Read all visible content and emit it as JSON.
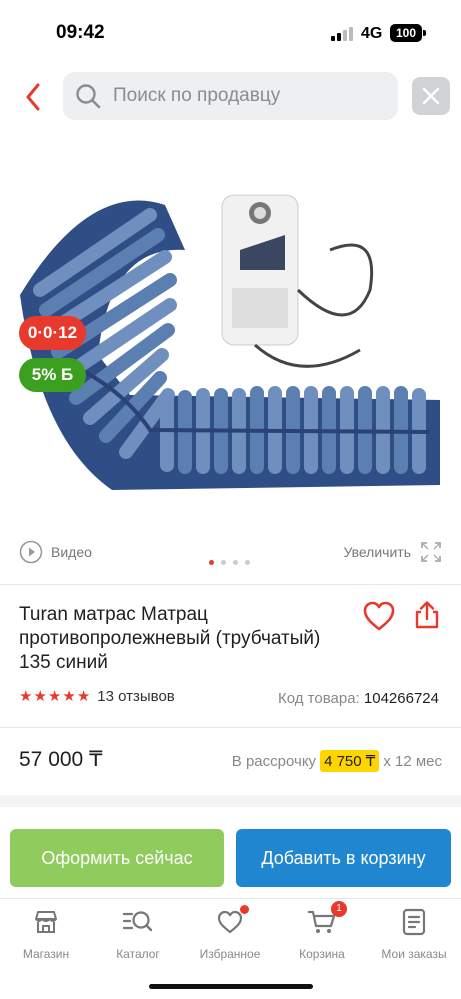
{
  "status_bar": {
    "time": "09:42",
    "network": "4G",
    "battery": "100"
  },
  "search": {
    "placeholder": "Поиск по продавцу"
  },
  "badges": {
    "timer": "0·0·12",
    "discount": "5% Б"
  },
  "media": {
    "video_label": "Видео",
    "zoom_label": "Увеличить",
    "slide_count": 4,
    "active_slide": 1
  },
  "product": {
    "title": "Turan матрас Матрац противопролежневый (трубчатый) 135 синий",
    "rating": 5,
    "reviews": "13 отзывов",
    "code_label": "Код товара:",
    "code_value": "104266724",
    "price": "57 000 ₸",
    "installment_prefix": "В рассрочку",
    "installment_amount": "4 750 ₸",
    "installment_suffix": "x 12 мес"
  },
  "actions": {
    "order_label": "Оформить сейчас",
    "cart_label": "Добавить в корзину"
  },
  "nav": {
    "items": [
      {
        "label": "Магазин",
        "icon": "shop-icon"
      },
      {
        "label": "Каталог",
        "icon": "catalog-search-icon"
      },
      {
        "label": "Избранное",
        "icon": "heart-icon"
      },
      {
        "label": "Корзина",
        "icon": "cart-icon",
        "count": "1"
      },
      {
        "label": "Мои заказы",
        "icon": "orders-icon"
      }
    ]
  },
  "colors": {
    "accent_red": "#e8392d",
    "green": "#3ba020",
    "order_button": "#8fcc5d",
    "cart_button": "#1f86cf",
    "installment_highlight": "#ffd500",
    "mattress_blue": "#4a6fa5"
  }
}
